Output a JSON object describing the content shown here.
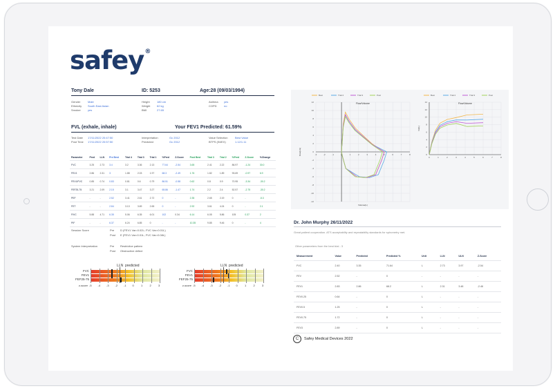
{
  "brand": {
    "logo": "safey",
    "reg": "®"
  },
  "patient": {
    "name": "Tony Dale",
    "id": "ID: 5253",
    "age": "Age:28  (09/03/1994)"
  },
  "demographics": [
    {
      "label": "Gender",
      "value": "Male"
    },
    {
      "label": "Ethnicity",
      "value": "South East Asian"
    },
    {
      "label": "Smoker",
      "value": "yes"
    }
  ],
  "measures": [
    {
      "label": "Height",
      "value": "180 cm"
    },
    {
      "label": "Weight",
      "value": "62 kg"
    },
    {
      "label": "BMI",
      "value": "27.65"
    }
  ],
  "conditions": [
    {
      "label": "Asthma",
      "value": "yes"
    },
    {
      "label": "COPD",
      "value": "no"
    }
  ],
  "fvl": {
    "title": "FVL (exhale, inhale)",
    "predicted": "Your FEV1 Predicted: 61.59%"
  },
  "test_info": {
    "test_date_label": "Test Date",
    "test_date": "17/11/2022  20:47:50",
    "post_time_label": "Post Time",
    "post_time": "17/11/2022  20:57:50",
    "interp_label": "Interpretation",
    "interp": "Gc 2012",
    "pred_label": "Predicted",
    "pred": "Gc 2012",
    "value_sel_label": "Value Selection",
    "value_sel": "Best Value",
    "btps_label": "BTPS (IN/EX)",
    "btps": "1.12/1.11"
  },
  "main_table": {
    "headers": [
      "Parameter",
      "Pred",
      "LLN",
      "Pre Best",
      "Trial 4",
      "Trial 3",
      "Trial 1",
      "%Pred",
      "Z-Score",
      "Post Best",
      "Trial 3",
      "Trial 2",
      "%Pred",
      "Z-Score",
      "%Change"
    ],
    "rows": [
      [
        "FVC",
        "3.25",
        "2.73",
        "3.4",
        "3.2",
        "3.36",
        "2.13",
        "77.64",
        "-2.54",
        "3.65",
        "2.41",
        "2.22",
        "86.97",
        "-1.24",
        "30.0"
      ],
      [
        "FEV1",
        "2.86",
        "2.31",
        "3",
        "1.88",
        "2.03",
        "1.97",
        "68.3",
        "-2.49",
        "1.76",
        "1.82",
        "1.89",
        "93.69",
        "-0.97",
        "6.9"
      ],
      [
        "FEV1/FVC",
        "0.85",
        "0.74",
        "0.83",
        "0.81",
        "0.6",
        "0.79",
        "86.51",
        "-0.58",
        "0.62",
        "0.8",
        "0.9",
        "70.95",
        "-3.34",
        "-30.2"
      ],
      [
        "FEF25-75",
        "3.21",
        "2.09",
        "2.15",
        "3.1",
        "3.47",
        "3.27",
        "65.86",
        "-1.47",
        "1.74",
        "2.2",
        "2.4",
        "52.57",
        "-2.75",
        "-30.2"
      ],
      [
        "PEF",
        "-",
        "-",
        "2.52",
        "3.41",
        "2.61",
        "2.72",
        "0",
        "-",
        "2.35",
        "2.65",
        "2.19",
        "0",
        "-",
        "-5.3"
      ],
      [
        "FET",
        "-",
        "-",
        "2.84",
        "3.13",
        "3.69",
        "2.65",
        "0",
        "-",
        "2.92",
        "3.61",
        "4.24",
        "0",
        "-",
        "2.1"
      ],
      [
        "FIVC",
        "5.88",
        "4.71",
        "6.35",
        "5.06",
        "6.35",
        "6.01",
        "102",
        "0.34",
        "6.14",
        "6.05",
        "5.86",
        "105",
        "0.37",
        "2"
      ],
      [
        "PIF",
        "-",
        "-",
        "6.37",
        "6.24",
        "6.85",
        "0",
        "-",
        "-",
        "10.35",
        "9.85",
        "9.46",
        "0",
        "-",
        "4"
      ]
    ]
  },
  "session": {
    "label": "Session Score",
    "pre_label": "Pre",
    "pre": "D (FEV1 Var=0.02L; FVC Var=0.01L)",
    "post_label": "Post",
    "post": "E (FEV1 Var=0.01L; FVC Var=0.08L)"
  },
  "system": {
    "label": "System Interpretation",
    "pre_label": "Pre",
    "pre": "Restrictive pattern",
    "post_label": "Post",
    "post": "Obstructive defect"
  },
  "zscore_charts": [
    {
      "lln_label": "LLN",
      "pred_label": "predicted",
      "rows": [
        "FVC",
        "FEV1",
        "FEF25-75"
      ],
      "axis_label": "z-score",
      "ticks": [
        "-5",
        "-4",
        "-3",
        "-2",
        "-1",
        "0",
        "1",
        "2",
        "3"
      ],
      "values": [
        -2.54,
        -2.49,
        -1.47
      ]
    },
    {
      "lln_label": "LLN",
      "pred_label": "predicted",
      "rows": [
        "FVC",
        "FEV1",
        "FEF25-75"
      ],
      "axis_label": "z-score",
      "ticks": [
        "-5",
        "-4",
        "-3",
        "-2",
        "-1",
        "0",
        "1",
        "2",
        "3"
      ],
      "values": [
        -1.24,
        -0.97,
        -2.75
      ]
    }
  ],
  "doctor": {
    "name": "Dr. John Murphy 26/11/2022",
    "note": "Great patient cooperation. ATS acceptability and repeatability standards for spirometry met."
  },
  "other": {
    "title": "Other parameters from the best trial - 3",
    "headers": [
      "Measurement",
      "Value",
      "Predicted",
      "Predicted %",
      "Unit",
      "LLN",
      "ULN",
      "Z-Score"
    ],
    "rows": [
      [
        "FVC",
        "2.40",
        "3.35",
        "71.64",
        "L",
        "2.73",
        "3.97",
        "-2.54"
      ],
      [
        "FEV",
        "2.52",
        "-",
        "0",
        "-",
        "-",
        "-",
        "-"
      ],
      [
        "FEV1",
        "2.83",
        "2.86",
        "68.2",
        "L",
        "2.31",
        "3.48",
        "-2.46"
      ],
      [
        "FEV0.25",
        "0.64",
        "-",
        "0",
        "L",
        "-",
        "-",
        "-"
      ],
      [
        "FEV0.5",
        "1.25",
        "-",
        "0",
        "L",
        "-",
        "-",
        "-"
      ],
      [
        "FEV0.75",
        "1.72",
        "-",
        "0",
        "L",
        "-",
        "-",
        "-"
      ],
      [
        "FEV3",
        "2.89",
        "-",
        "0",
        "L",
        "-",
        "-",
        "-"
      ]
    ]
  },
  "footer": {
    "copyright": "Safey Medical Devices 2022",
    "symbol": "C"
  },
  "flow_chart": {
    "title": "Flow/Volume",
    "ylabel": "Flow(L/s)",
    "xlabel": "Volume(L)",
    "legend": [
      "Best",
      "Trial 2",
      "Trial 3",
      "Post"
    ],
    "colors": [
      "#f2b74a",
      "#5aa9e6",
      "#c15cd6",
      "#a2d25a"
    ]
  },
  "vt_chart": {
    "title": "Flow/Volume",
    "ylabel": "Vol(L)",
    "legend": [
      "Best",
      "Trial 2",
      "Trial 3",
      "Post"
    ],
    "colors": [
      "#f2b74a",
      "#5aa9e6",
      "#c15cd6",
      "#a2d25a"
    ]
  }
}
